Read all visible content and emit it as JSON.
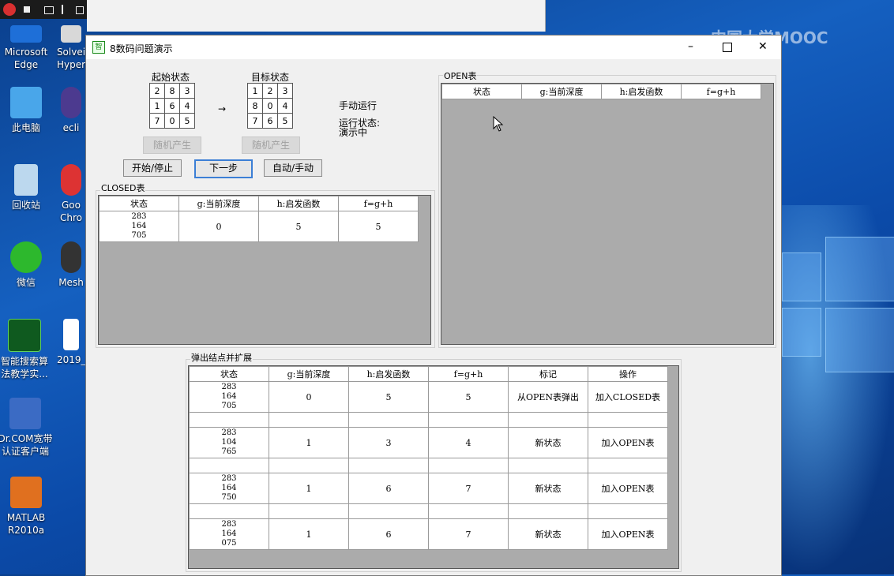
{
  "window": {
    "title": "8数码问题演示"
  },
  "start": {
    "label": "起始状态",
    "grid": [
      "2",
      "8",
      "3",
      "1",
      "6",
      "4",
      "7",
      "0",
      "5"
    ],
    "random_label": "随机产生"
  },
  "goal": {
    "label": "目标状态",
    "grid": [
      "1",
      "2",
      "3",
      "8",
      "0",
      "4",
      "7",
      "6",
      "5"
    ],
    "random_label": "随机产生"
  },
  "arrow": "→",
  "status": {
    "mode": "手动运行",
    "state_label": "运行状态:",
    "state_value": "演示中"
  },
  "buttons": {
    "start_stop": "开始/停止",
    "next_step": "下一步",
    "auto_manual": "自动/手动"
  },
  "closed": {
    "label": "CLOSED表",
    "columns": [
      "状态",
      "g:当前深度",
      "h:启发函数",
      "f=g+h"
    ],
    "rows": [
      {
        "state": [
          "283",
          "164",
          "705"
        ],
        "g": "0",
        "h": "5",
        "f": "5"
      }
    ]
  },
  "open": {
    "label": "OPEN表",
    "columns": [
      "状态",
      "g:当前深度",
      "h:启发函数",
      "f=g+h"
    ]
  },
  "expand": {
    "label": "弹出结点并扩展",
    "columns": [
      "状态",
      "g:当前深度",
      "h:启发函数",
      "f=g+h",
      "标记",
      "操作"
    ],
    "rows": [
      {
        "state": [
          "283",
          "164",
          "705"
        ],
        "g": "0",
        "h": "5",
        "f": "5",
        "mark": "从OPEN表弹出",
        "op": "加入CLOSED表"
      },
      {
        "state": [
          "283",
          "104",
          "765"
        ],
        "g": "1",
        "h": "3",
        "f": "4",
        "mark": "新状态",
        "op": "加入OPEN表"
      },
      {
        "state": [
          "283",
          "164",
          "750"
        ],
        "g": "1",
        "h": "6",
        "f": "7",
        "mark": "新状态",
        "op": "加入OPEN表"
      },
      {
        "state": [
          "283",
          "164",
          "075"
        ],
        "g": "1",
        "h": "6",
        "f": "7",
        "mark": "新状态",
        "op": "加入OPEN表"
      }
    ]
  },
  "desktop": {
    "icons": [
      "Microsoft Edge",
      "此电脑",
      "回收站",
      "微信",
      "智能搜索算法教学实...",
      "Dr.COM宽带认证客户端",
      "MATLAB R2010a"
    ],
    "partial_icons": [
      "Solvei Hyper",
      "ecli",
      "Goo Chro",
      "Mesh",
      "2019_"
    ],
    "watermark": "中国大学MOOC"
  },
  "colors": {
    "table_bg": "#ababab",
    "focus": "#3c7fd6"
  }
}
